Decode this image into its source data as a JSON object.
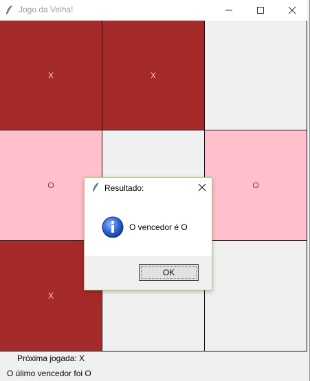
{
  "window": {
    "title": "Jogo da Velha!",
    "icon": "feather-icon"
  },
  "board": {
    "colors": {
      "x_bg": "#a52a2a",
      "x_text": "#ffc0cb",
      "o_bg": "#ffc0cb",
      "o_text": "#a52a2a",
      "empty_bg": "#f0f0f0"
    },
    "cells": [
      "X",
      "X",
      "",
      "O",
      "",
      "O",
      "X",
      "",
      ""
    ]
  },
  "status": {
    "next_move": "Próxima jogada: X",
    "last_winner": "O úlimo vencedor foi O"
  },
  "dialog": {
    "title": "Resultado:",
    "icon": "info-icon",
    "message": "O vencedor é O",
    "ok_label": "OK"
  }
}
